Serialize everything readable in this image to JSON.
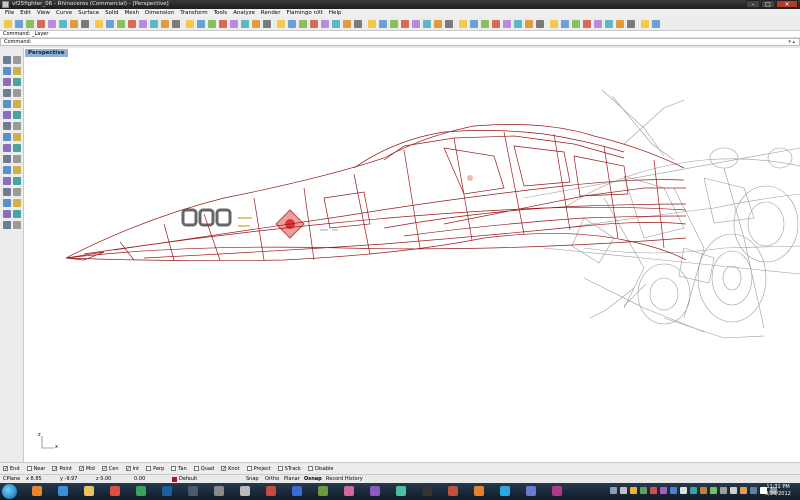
{
  "window": {
    "title": "vf25fighter_06 - Rhinoceros (Commercial) - [Perspective]",
    "buttons": {
      "minimize": "–",
      "maximize": "□",
      "close": "✕"
    }
  },
  "menu": [
    "File",
    "Edit",
    "View",
    "Curve",
    "Surface",
    "Solid",
    "Mesh",
    "Dimension",
    "Transform",
    "Tools",
    "Analyze",
    "Render",
    "Flamingo nXt",
    "Help"
  ],
  "toolbar": {
    "icons": [
      "new-icon",
      "open-icon",
      "save-icon",
      "print-icon",
      "import-icon",
      "export-icon",
      "cut-icon",
      "copy-icon",
      "paste-icon",
      "undo-icon",
      "redo-icon",
      "pan-icon",
      "rotate-view-icon",
      "zoom-icon",
      "zoom-window-icon",
      "zoom-extents-icon",
      "zoom-selected-icon",
      "undo-view-icon",
      "select-icon",
      "grid-icon",
      "points-on-icon",
      "points-off-icon",
      "properties-icon",
      "layer-icon",
      "shade-icon",
      "render-icon",
      "light-icon",
      "lock-icon",
      "hide-icon",
      "show-icon",
      "help-icon",
      "snap-icon",
      "osnap-icon",
      "box-icon",
      "sphere-icon",
      "cylinder-icon",
      "cone-icon",
      "torus-icon",
      "mesh-icon",
      "surface-icon",
      "extrude-icon",
      "loft-icon",
      "sweep-icon",
      "revolve-icon",
      "boolean-icon",
      "fillet-icon",
      "shell-icon",
      "analyze-icon",
      "curvature-icon",
      "zebra-icon",
      "draft-icon",
      "env-map-icon",
      "render-preview-icon",
      "flamingo-icon",
      "material-icon",
      "sun-icon",
      "camera-icon",
      "dimension-icon"
    ]
  },
  "command": {
    "history": "Command: _Layer",
    "prompt": "Command:",
    "arrows": "▾  ▴"
  },
  "viewport": {
    "tab": "Perspective",
    "axis": {
      "x": "x",
      "z": "z"
    }
  },
  "osnap": [
    {
      "label": "End",
      "checked": true
    },
    {
      "label": "Near",
      "checked": false
    },
    {
      "label": "Point",
      "checked": true
    },
    {
      "label": "Mid",
      "checked": true
    },
    {
      "label": "Cen",
      "checked": true
    },
    {
      "label": "Int",
      "checked": true
    },
    {
      "label": "Perp",
      "checked": false
    },
    {
      "label": "Tan",
      "checked": false
    },
    {
      "label": "Quad",
      "checked": false
    },
    {
      "label": "Knot",
      "checked": true
    },
    {
      "label": "Project",
      "checked": false
    },
    {
      "label": "STrack",
      "checked": false
    },
    {
      "label": "Disable",
      "checked": false
    }
  ],
  "status": {
    "cplane": "CPlane",
    "x": "x 8.85",
    "y": "y -9.97",
    "z": "z 0.00",
    "distance": "0.00",
    "layer": "Default",
    "toggles": [
      "Snap",
      "Ortho",
      "Planar",
      "Osnap",
      "Record History"
    ],
    "layer_color": "#b5121b"
  },
  "taskbar": {
    "clock_time": "11:31 PM",
    "clock_date": "9/20/2012"
  },
  "colors": {
    "wire_red": "#9a1a1a",
    "wire_gray": "#9c9c9c",
    "viewport_tab": "#93b2d3"
  }
}
